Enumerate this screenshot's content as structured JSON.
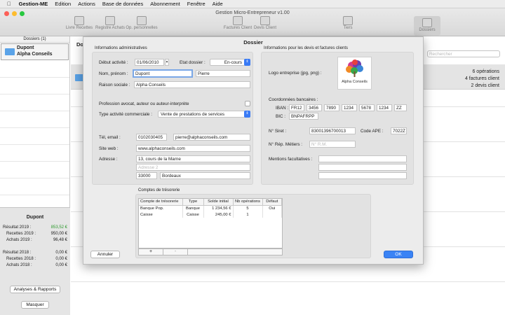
{
  "menubar": {
    "apple": "",
    "items": [
      "Gestion-ME",
      "Edition",
      "Actions",
      "Base de données",
      "Abonnement",
      "Fenêtre",
      "Aide"
    ]
  },
  "window": {
    "title": "Gestion Micro-Entrepreneur v1.00"
  },
  "toolbar": {
    "items": [
      "Livre Recettes",
      "Registre Achats",
      "Op. personnelles",
      "Factures Client",
      "Devis Client",
      "Tiers",
      "Dossiers"
    ]
  },
  "sidebar": {
    "header": "Dossiers (1)",
    "dossier_name": "Dupont",
    "dossier_company": "Alpha Conseils"
  },
  "stats": {
    "title": "Dupont",
    "rows": [
      [
        "Résultat 2019 :",
        "853,52 €"
      ],
      [
        "Recettes 2019 :",
        "950,00 €"
      ],
      [
        "Achats 2019 :",
        "96,48 €"
      ],
      [
        "Résultat 2018 :",
        "0,00 €"
      ],
      [
        "Recettes 2018 :",
        "0,00 €"
      ],
      [
        "Achats 2018 :",
        "0,00 €"
      ]
    ],
    "analyses_btn": "Analyses & Rapports",
    "masquer_btn": "Masquer",
    "positive_color": "#2e9a2e"
  },
  "main": {
    "header_initial": "Do",
    "search_placeholder": "Rechercher",
    "summary": [
      "6 opérations",
      "4 factures client",
      "2 devis client"
    ]
  },
  "dialog": {
    "title": "Dossier",
    "admin": {
      "heading": "Informations administratives",
      "debut_label": "Début activité :",
      "debut_value": "01/06/2010",
      "etat_label": "Etat dossier :",
      "etat_value": "En-cours",
      "nom_label": "Nom, prénom :",
      "nom_value": "Dupont",
      "prenom_value": "Pierre",
      "raison_label": "Raison sociale :",
      "raison_value": "Alpha Conseils",
      "profession_label": "Profession avocat, auteur ou auteur-interprète",
      "type_label": "Type activité commerciale :",
      "type_value": "Vente de prestations de services",
      "tel_label": "Tél, email :",
      "tel_value": "0102030405",
      "email_value": "pierre@alphaconseils.com",
      "site_label": "Site web :",
      "site_value": "www.alphaconseils.com",
      "adresse_label": "Adresse :",
      "adresse1_value": "13, cours de la Marne",
      "adresse2_placeholder": "Adresse 2",
      "cp_value": "33000",
      "ville_value": "Bordeaux"
    },
    "devis": {
      "heading": "Informations pour les devis et factures clients",
      "logo_label": "Logo entreprise (jpg, png) :",
      "logo_text": "Alpha Conseils",
      "banque_label": "Coordonnées bancaires :",
      "iban_label": "IBAN :",
      "iban": [
        "FR12",
        "3456",
        "7890",
        "1234",
        "5678",
        "1234",
        "ZZ"
      ],
      "bic_label": "BIC :",
      "bic_value": "BNPAFRPP",
      "siret_label": "N° Siret :",
      "siret_value": "83001396700013",
      "ape_label": "Code APE :",
      "ape_value": "7022Z",
      "rm_label": "N° Rép. Métiers :",
      "rm_placeholder": "N° R.M.",
      "mentions_label": "Mentions facultatives :"
    },
    "comptes": {
      "heading": "Comptes de trésorerie",
      "columns": [
        "Compte de trésorerie",
        "Type",
        "Solde initial",
        "Nb opérations",
        "Défaut"
      ],
      "rows": [
        [
          "Banque Pop.",
          "Banque",
          "1 234,56 €",
          "5",
          "Oui"
        ],
        [
          "Caisse",
          "Caisse",
          "245,00 €",
          "1",
          ""
        ]
      ],
      "add": "+",
      "remove": "-"
    },
    "annuler": "Annuler",
    "ok": "OK"
  }
}
